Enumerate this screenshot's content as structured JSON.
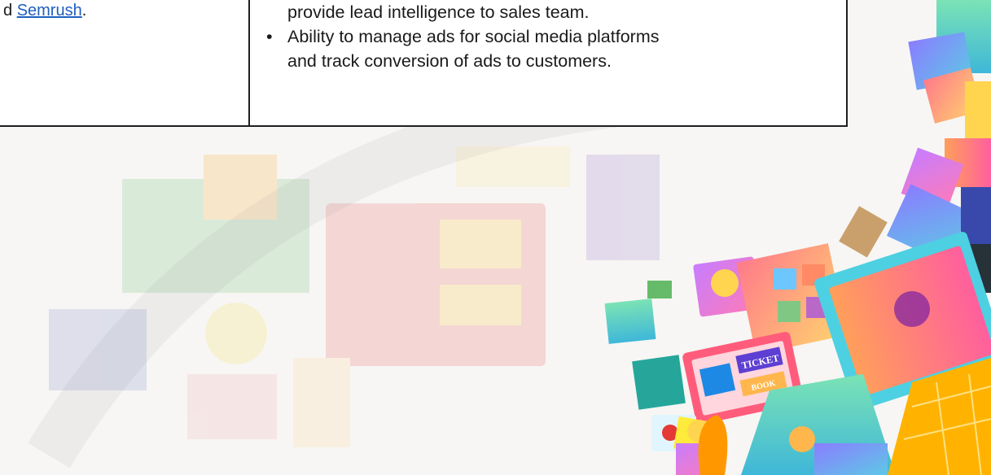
{
  "left_cell": {
    "prefix": "d ",
    "link_text": "Semrush",
    "suffix": "."
  },
  "right_cell": {
    "fragment_line": "provide lead intelligence to sales team.",
    "bullets": [
      {
        "symbol": "•",
        "line1": "Ability to manage ads for social media platforms",
        "line2": "and track conversion of ads to customers."
      }
    ]
  },
  "illustration": {
    "ticket_label": "TICKET",
    "book_label": "BOOK"
  },
  "colors": {
    "border": "#1f1f1f",
    "link": "#1f5fbf",
    "text": "#1a1a1a"
  }
}
